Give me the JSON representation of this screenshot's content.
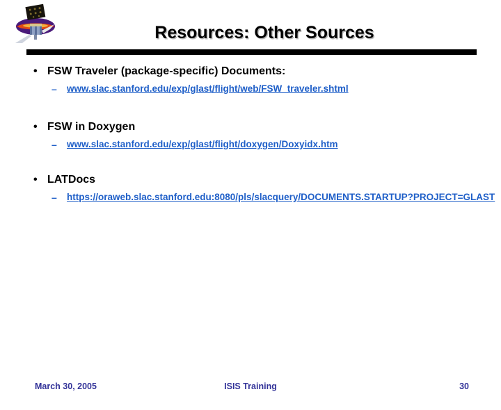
{
  "slide": {
    "title": "Resources: Other Sources",
    "logo_icon": "glast-satellite-logo-icon",
    "bullet_marker": "•",
    "sub_marker": "–",
    "link_color": "#1f5fc8",
    "title_color": "#000000",
    "footer_color": "#333399",
    "rule_color": "#000000",
    "groups": [
      {
        "heading": "FSW Traveler (package-specific) Documents:",
        "links": [
          {
            "text": "www.slac.stanford.edu/exp/glast/flight/web/FSW_traveler.shtml"
          }
        ]
      },
      {
        "heading": "FSW in Doxygen",
        "links": [
          {
            "text": "www.slac.stanford.edu/exp/glast/flight/doxygen/Doxyidx.htm"
          }
        ]
      },
      {
        "heading": "LATDocs",
        "links": [
          {
            "text": "https://oraweb.slac.stanford.edu:8080/pls/slacquery/DOCUMENTS.STARTUP?PROJECT=GLAST"
          }
        ]
      }
    ]
  },
  "footer": {
    "date": "March 30, 2005",
    "center": "ISIS Training",
    "page_number": "30"
  }
}
